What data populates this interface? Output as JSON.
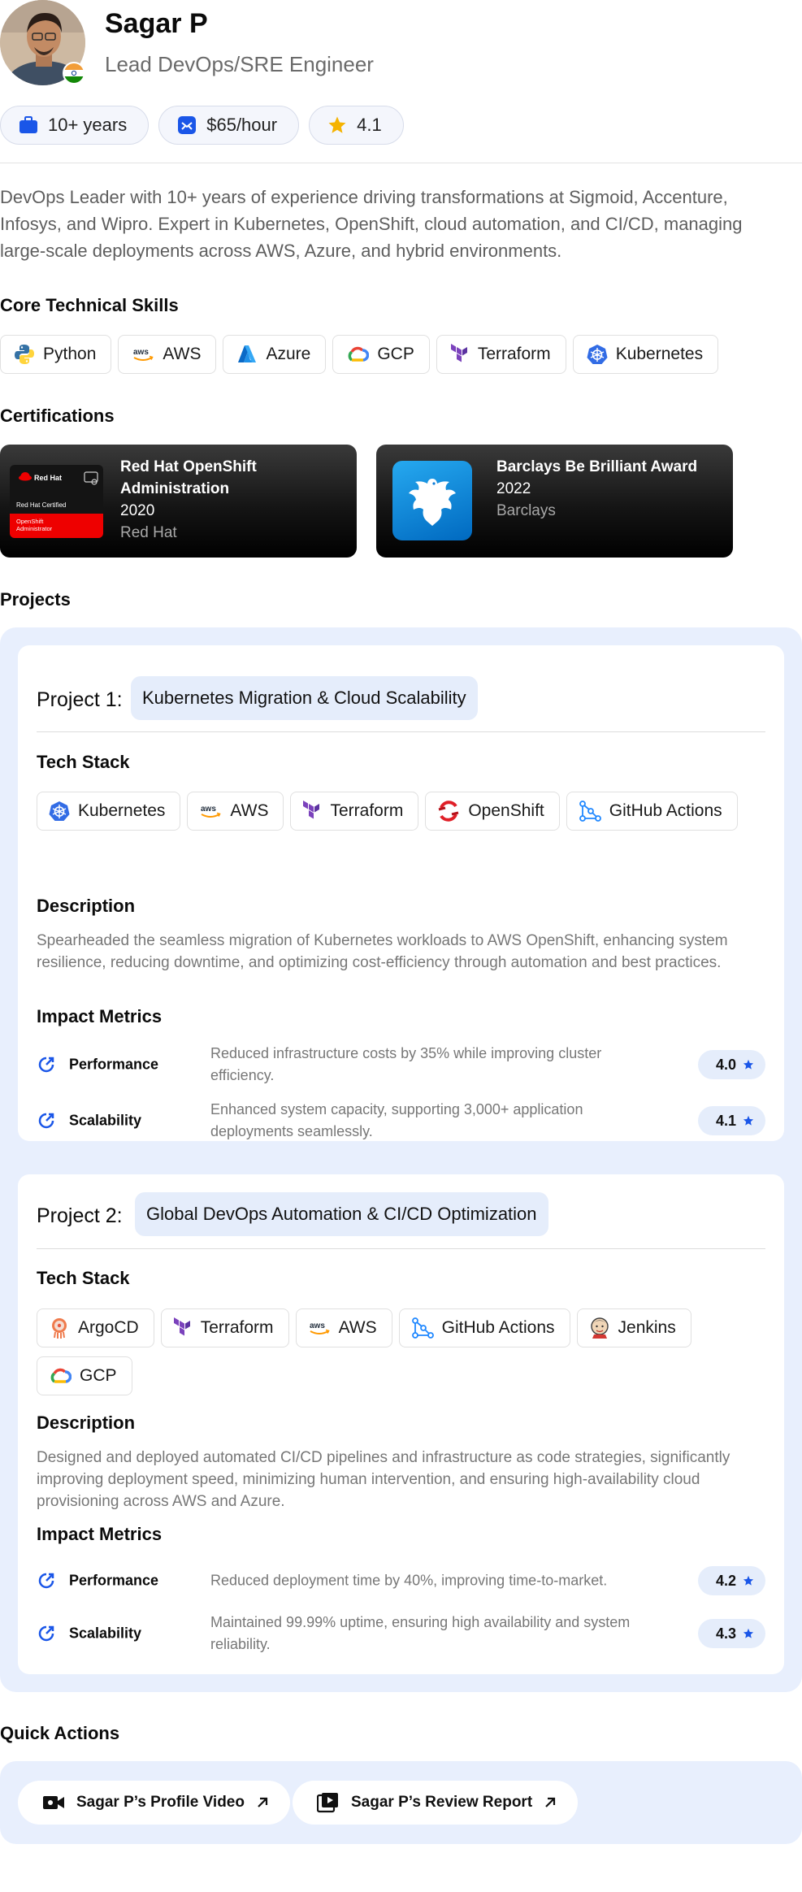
{
  "profile": {
    "name": "Sagar P",
    "role": "Lead DevOps/SRE Engineer",
    "experience": "10+ years",
    "rate": "$65/hour",
    "rating": "4.1",
    "summary": "DevOps Leader with 10+ years of experience driving transformations at Sigmoid, Accenture, Infosys, and Wipro. Expert in Kubernetes, OpenShift, cloud automation, and CI/CD, managing large-scale deployments across AWS, Azure, and hybrid environments."
  },
  "sections": {
    "skills": "Core Technical Skills",
    "certifications": "Certifications",
    "projects": "Projects",
    "quick_actions": "Quick Actions",
    "tech_stack": "Tech Stack",
    "description": "Description",
    "impact_metrics": "Impact Metrics"
  },
  "skills": [
    "Python",
    "AWS",
    "Azure",
    "GCP",
    "Terraform",
    "Kubernetes"
  ],
  "certifications": [
    {
      "title": "Red Hat OpenShift Administration",
      "year": "2020",
      "issuer": "Red Hat",
      "logo_lines": [
        "Red Hat",
        "Red Hat Certified",
        "OpenShift",
        "Administrator"
      ]
    },
    {
      "title": "Barclays Be Brilliant Award",
      "year": "2022",
      "issuer": "Barclays"
    }
  ],
  "projects": [
    {
      "label": "Project 1:",
      "name": "Kubernetes Migration & Cloud Scalability",
      "stack": [
        "Kubernetes",
        "AWS",
        "Terraform",
        "OpenShift",
        "GitHub Actions"
      ],
      "description": "Spearheaded the seamless migration of Kubernetes workloads to AWS OpenShift, enhancing system resilience, reducing downtime, and optimizing cost-efficiency through automation and best practices.",
      "metrics": [
        {
          "name": "Performance",
          "text": "Reduced infrastructure costs by 35% while improving cluster efficiency.",
          "score": "4.0"
        },
        {
          "name": "Scalability",
          "text": "Enhanced system capacity, supporting 3,000+ application deployments seamlessly.",
          "score": "4.1"
        }
      ]
    },
    {
      "label": "Project 2:",
      "name": "Global DevOps Automation & CI/CD Optimization",
      "stack": [
        "ArgoCD",
        "Terraform",
        "AWS",
        "GitHub Actions",
        "Jenkins",
        "GCP"
      ],
      "description": "Designed and deployed automated CI/CD pipelines and infrastructure as code strategies, significantly improving deployment speed, minimizing human intervention, and ensuring high-availability cloud provisioning across AWS and Azure.",
      "metrics": [
        {
          "name": "Performance",
          "text": "Reduced deployment time by 40%, improving time-to-market.",
          "score": "4.2"
        },
        {
          "name": "Scalability",
          "text": "Maintained 99.99% uptime, ensuring high availability and system reliability.",
          "score": "4.3"
        }
      ]
    }
  ],
  "quick_actions": [
    {
      "label": "Sagar P’s Profile Video",
      "icon": "video-camera-icon"
    },
    {
      "label": "Sagar P’s Review Report",
      "icon": "video-file-icon"
    }
  ],
  "aws_wordmark": "aws",
  "colors": {
    "accent": "#1a56e8",
    "chip_bg": "#f4f6fc",
    "projects_bg": "#e8effd",
    "pill_bg": "#e5edfb",
    "star": "#f5b301"
  }
}
